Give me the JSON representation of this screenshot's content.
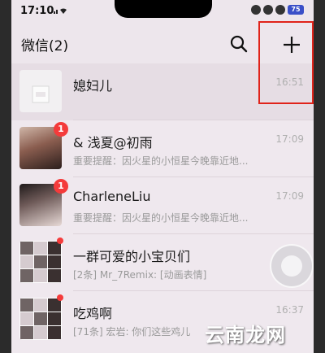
{
  "status": {
    "time": "17:10",
    "network": "..ll",
    "battery": "75"
  },
  "header": {
    "title": "微信(2)",
    "search_icon": "search-icon",
    "add_icon": "plus-icon"
  },
  "chats": [
    {
      "name": "媳妇儿",
      "preview": "",
      "time": "16:51",
      "badge": "",
      "dot": false,
      "pinned": true
    },
    {
      "name": "& 浅夏@初雨",
      "preview": "重要提醒：因火星的小恒星今晚靠近地...",
      "time": "17:09",
      "badge": "1",
      "dot": false
    },
    {
      "name": "CharleneLiu",
      "preview": "重要提醒：因火星的小恒星今晚靠近地...",
      "time": "17:09",
      "badge": "1",
      "dot": false
    },
    {
      "name": "一群可爱的小宝贝们",
      "preview": "[2条] Mr_7Remix: [动画表情]",
      "time": "",
      "badge": "",
      "dot": true
    },
    {
      "name": "吃鸡啊",
      "preview": "[71条] 宏岩: 你们这些鸡儿",
      "time": "16:37",
      "badge": "",
      "dot": true
    }
  ],
  "watermark": "云南龙网",
  "colors": {
    "highlight_box": "#e0231a",
    "badge": "#f43b3b"
  }
}
